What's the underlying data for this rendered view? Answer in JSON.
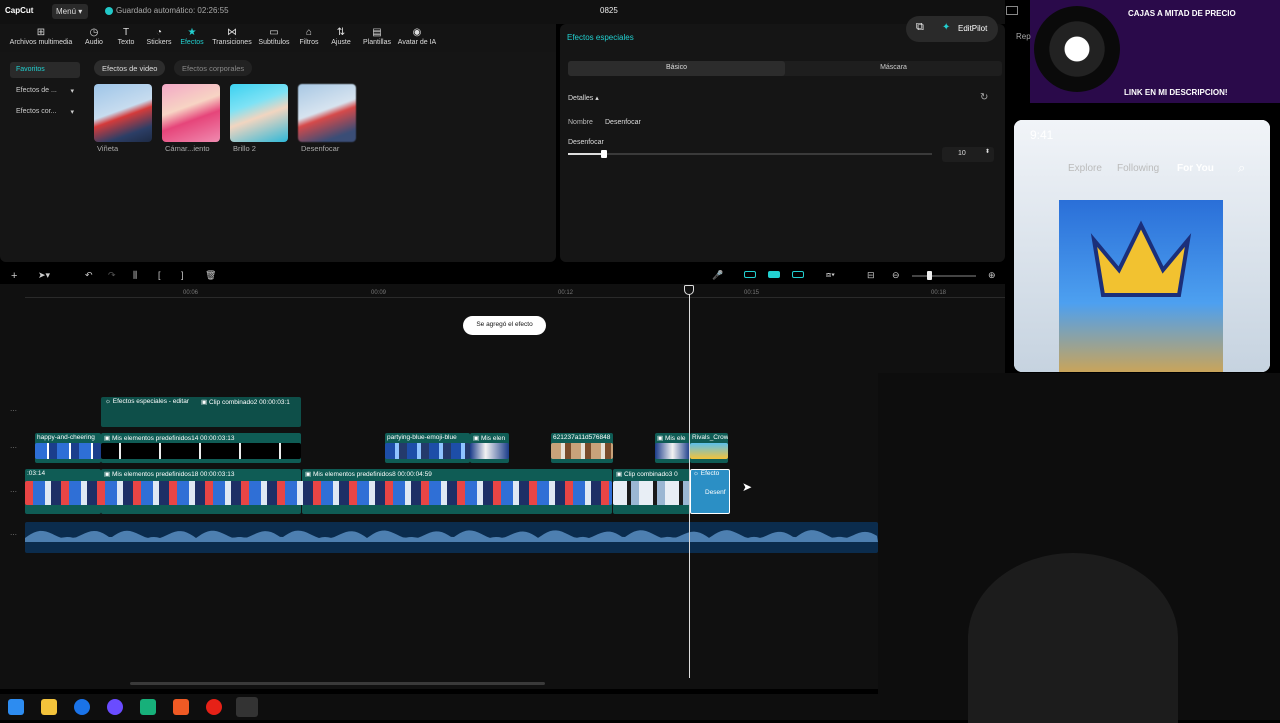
{
  "titlebar": {
    "logo": "CapCut",
    "menu_label": "Menú",
    "autosave": "Guardado automático: 02:26:55",
    "project_name": "0825"
  },
  "toolbar": [
    {
      "label": "Archivos multimedia",
      "icon": "media-icon"
    },
    {
      "label": "Audio",
      "icon": "audio-icon"
    },
    {
      "label": "Texto",
      "icon": "text-icon"
    },
    {
      "label": "Stickers",
      "icon": "sticker-icon"
    },
    {
      "label": "Efectos",
      "icon": "effects-icon",
      "active": true
    },
    {
      "label": "Transiciones",
      "icon": "transition-icon"
    },
    {
      "label": "Subtítulos",
      "icon": "subtitle-icon"
    },
    {
      "label": "Filtros",
      "icon": "filter-icon"
    },
    {
      "label": "Ajuste",
      "icon": "adjust-icon"
    },
    {
      "label": "Plantillas",
      "icon": "template-icon"
    },
    {
      "label": "Avatar de IA",
      "icon": "ai-avatar-icon"
    }
  ],
  "sidebar": {
    "items": [
      {
        "label": "Favoritos"
      },
      {
        "label": "Efectos de ..."
      },
      {
        "label": "Efectos cor..."
      }
    ]
  },
  "effects": {
    "tabs": [
      {
        "label": "Efectos de video"
      },
      {
        "label": "Efectos corporales"
      }
    ],
    "items": [
      {
        "label": "Viñeta"
      },
      {
        "label": "Cámar...iento"
      },
      {
        "label": "Brillo 2"
      },
      {
        "label": "Desenfocar"
      }
    ]
  },
  "details": {
    "panel_title": "Efectos especiales",
    "seg_basic": "Básico",
    "seg_mask": "Máscara",
    "section": "Detalles",
    "name_label": "Nombre",
    "name_value": "Desenfocar",
    "slider_label": "Desenfocar",
    "slider_value": "10",
    "slider_fraction": 0.1
  },
  "editpilot": {
    "label": "EditPilot"
  },
  "timeline": {
    "ticks": [
      "00:06",
      "00:09",
      "00:12",
      "00:15",
      "00:18"
    ],
    "toast": "Se agregó el efecto",
    "clips": {
      "fx_track": "Efectos especiales - editar",
      "combined2": "Clip combinado2  00:00:03:1",
      "t2_a": "happy-and-cheering",
      "t2_b": "Mis elementos predefinidos14  00:00:03:13",
      "t2_c": "partying-blue-emoji-blue",
      "t2_d": "Mis elen",
      "t2_e": "621237a11d576848",
      "t2_f": "Mis ele",
      "t2_g": "Rivals_Crow",
      "t3_a": ":03:14",
      "t3_b": "Mis elementos predefinidos18  00:00:03:13",
      "t3_c": "Mis elementos predefinidos8  00:00:04:59",
      "t3_d": "Clip combinado3  0",
      "t3_e": "Efecto",
      "t3_f": "Desenf"
    }
  },
  "overlay": {
    "ad_line1": "CAJAS A MITAD DE PRECIO",
    "ad_line2": "LINK EN MI DESCRIPCION!",
    "phone_time": "9:41",
    "phone_tabs": [
      "Explore",
      "Following",
      "For You"
    ],
    "rep_label": "Rep"
  }
}
